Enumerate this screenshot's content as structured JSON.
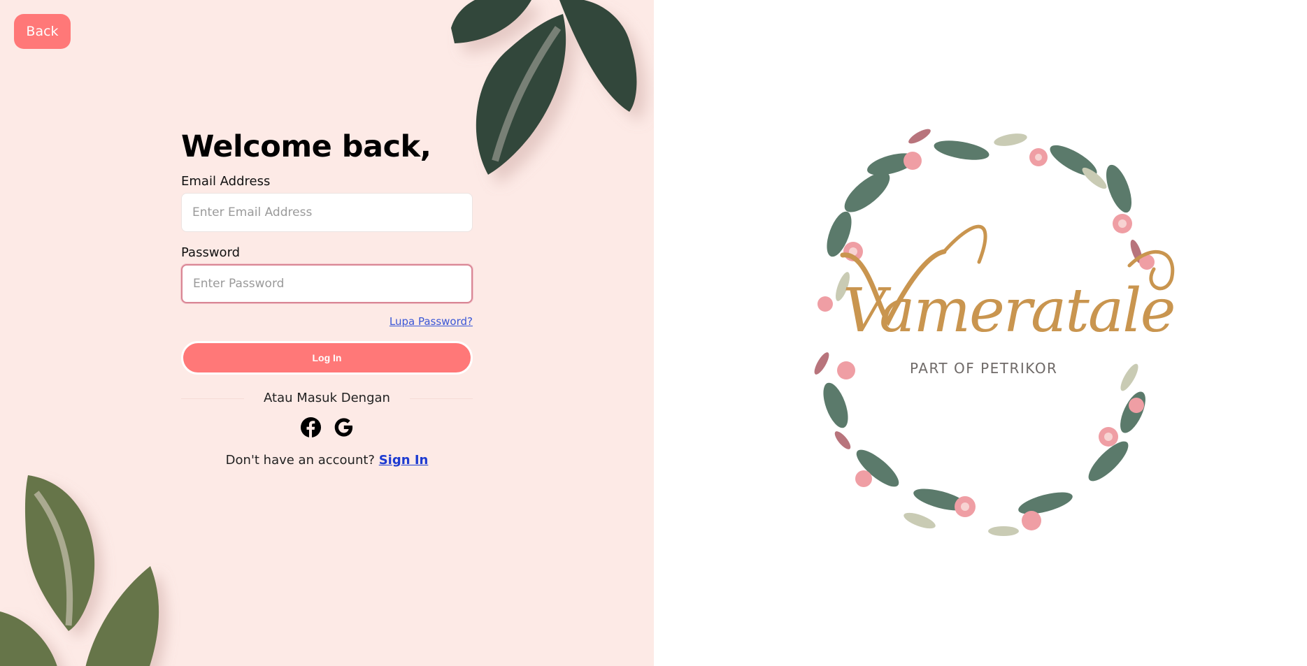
{
  "back": {
    "label": "Back"
  },
  "form": {
    "title": "Welcome back,",
    "email_label": "Email Address",
    "email_placeholder": "Enter Email Address",
    "email_value": "",
    "password_label": "Password",
    "password_placeholder": "Enter Password",
    "password_value": "",
    "forgot_link": "Lupa Password?",
    "login_button": "Log In",
    "divider_text": "Atau Masuk Dengan",
    "social": [
      {
        "icon": "facebook-icon"
      },
      {
        "icon": "google-icon"
      }
    ],
    "signup_prompt": "Don't have an account?",
    "signup_link": "Sign In"
  },
  "brand": {
    "name": "Vameratale",
    "tagline": "PART OF PETRIKOR"
  },
  "colors": {
    "accent": "#ff7878",
    "left_background": "#fdeae6",
    "leaf_dark": "#30463a",
    "leaf_olive": "#667449",
    "logo_gold": "#c9954f",
    "logo_text": "#6f6a68",
    "link_blue": "#3a57d6"
  }
}
